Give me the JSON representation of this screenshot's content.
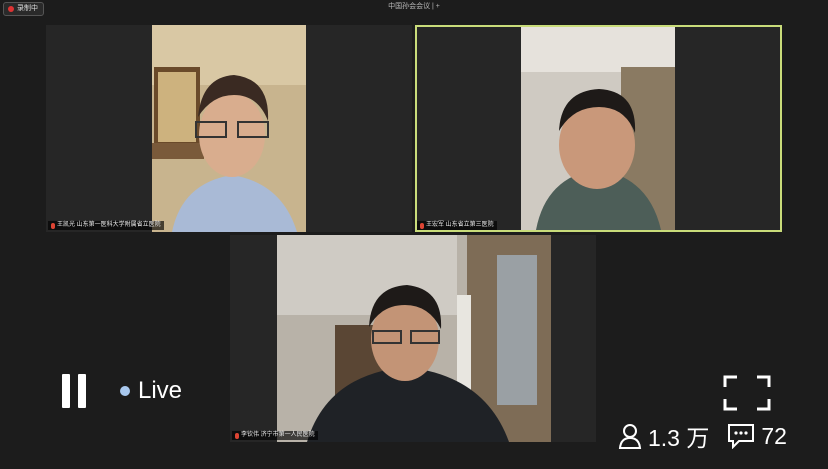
{
  "top_bar": {
    "recording_label": "录制中",
    "meeting_title": "中国孙会会议 | +"
  },
  "participants": [
    {
      "name_tag": "王凯光  山东第一医科大学附属省立医院",
      "active": false
    },
    {
      "name_tag": "王宏军  山东省立第三医院",
      "active": true
    },
    {
      "name_tag": "李钦伟  济宁市第一人民医院",
      "active": false
    }
  ],
  "player": {
    "status_label": "Live",
    "viewers": "1.3 万",
    "comments": "72",
    "icons": [
      "pause-icon",
      "live-dot",
      "fullscreen-icon",
      "viewers-icon",
      "comments-icon"
    ],
    "accent_color": "#c9dc7a",
    "live_dot_color": "#a9c8ee"
  }
}
